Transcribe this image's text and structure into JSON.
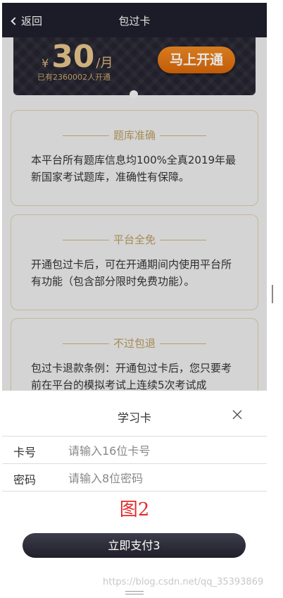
{
  "navbar": {
    "back_label": "返回",
    "title": "包过卡"
  },
  "banner": {
    "currency": "¥",
    "price": "30",
    "unit": "/月",
    "subscribers": "已有2360002人开通",
    "open_button": "马上开通"
  },
  "cards": [
    {
      "title": "题库准确",
      "body": "本平台所有题库信息均100%全真2019年最新国家考试题库，准确性有保障。"
    },
    {
      "title": "平台全免",
      "body": "开通包过卡后，可在开通期间内使用平台所有功能（包含部分限时免费功能）。"
    },
    {
      "title": "不过包退",
      "body": "包过卡退款条例：开通包过卡后，您只要考前在平台的模拟考试上连续5次考试成"
    }
  ],
  "sheet": {
    "title": "学习卡",
    "card_no_label": "卡号",
    "card_no_placeholder": "请输入16位卡号",
    "password_label": "密码",
    "password_placeholder": "请输入8位密码",
    "figure_label": "图2",
    "pay_button": "立即支付3"
  },
  "watermark": "https://blog.csdn.net/qq_35393869",
  "colors": {
    "navbar": "#20202d",
    "accent_orange": "#f08a24",
    "gold": "#b89b5e",
    "figure_red": "#e32b2b"
  }
}
